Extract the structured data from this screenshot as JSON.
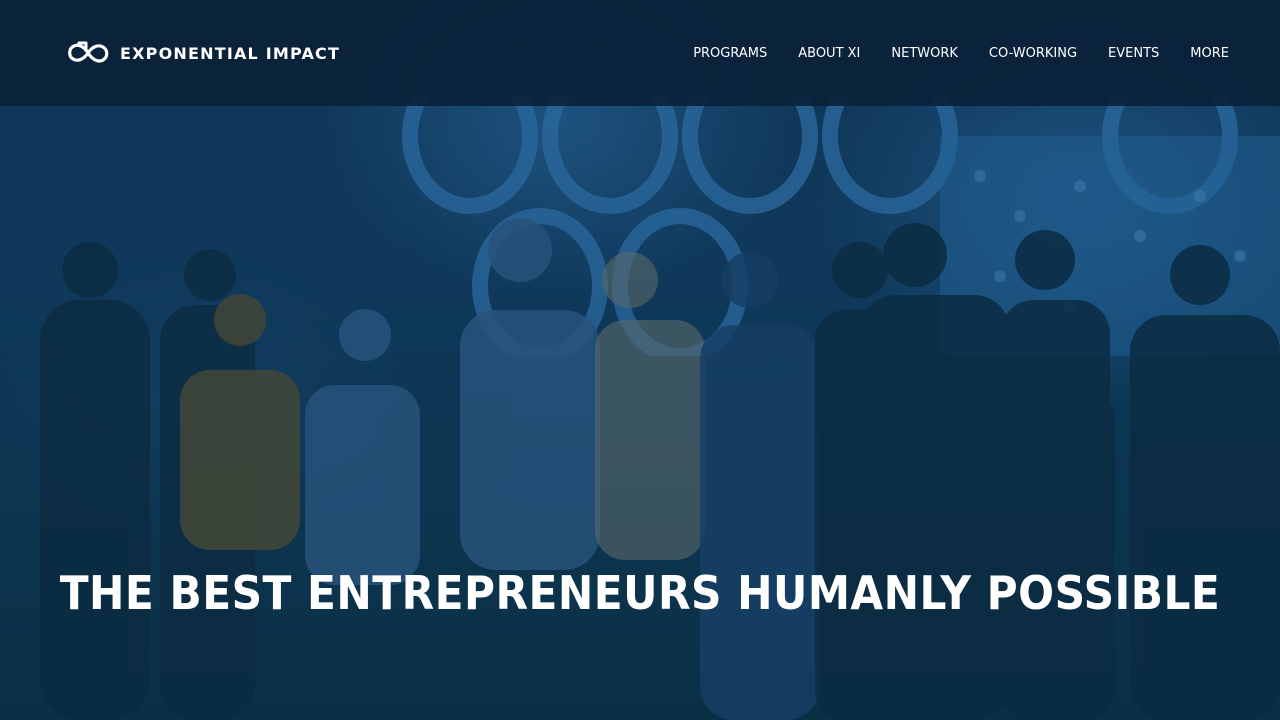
{
  "header": {
    "brand_name": "EXPONENTIAL IMPACT",
    "brand_logo_icon": "infinity-arrow-logo-icon",
    "nav_items": [
      {
        "label": "PROGRAMS"
      },
      {
        "label": "ABOUT XI"
      },
      {
        "label": "NETWORK"
      },
      {
        "label": "CO-WORKING"
      },
      {
        "label": "EVENTS"
      },
      {
        "label": "MORE"
      }
    ]
  },
  "hero": {
    "headline": "THE BEST ENTREPRENEURS HUMANLY POSSIBLE",
    "image_description_icon": "group-on-stage-photo"
  },
  "colors": {
    "header_background": "#091e34",
    "hero_tint": "#0b2b46",
    "text": "#ffffff",
    "stage_blue": "#3c8cd2"
  }
}
